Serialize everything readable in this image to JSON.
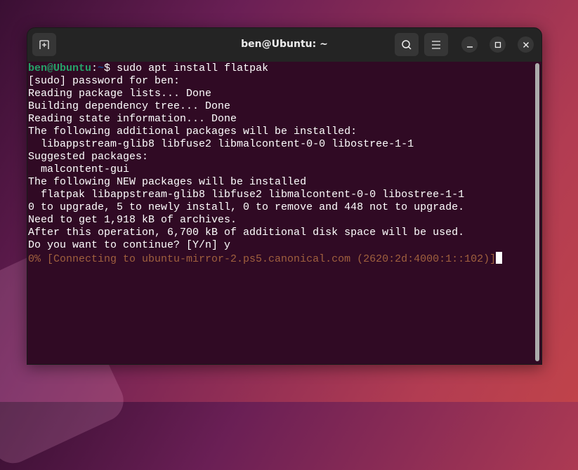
{
  "window": {
    "title": "ben@Ubuntu: ~"
  },
  "header": {
    "new_tab_icon": "new-tab-icon",
    "search_icon": "search-icon",
    "menu_icon": "hamburger-menu-icon",
    "minimize_icon": "minimize-icon",
    "maximize_icon": "maximize-icon",
    "close_icon": "close-icon"
  },
  "terminal": {
    "prompt_user": "ben@Ubuntu",
    "prompt_sep": ":",
    "prompt_path": "~",
    "prompt_symbol": "$ ",
    "command": "sudo apt install flatpak",
    "lines": [
      "[sudo] password for ben:",
      "Reading package lists... Done",
      "Building dependency tree... Done",
      "Reading state information... Done",
      "The following additional packages will be installed:",
      "  libappstream-glib8 libfuse2 libmalcontent-0-0 libostree-1-1",
      "Suggested packages:",
      "  malcontent-gui",
      "The following NEW packages will be installed",
      "  flatpak libappstream-glib8 libfuse2 libmalcontent-0-0 libostree-1-1",
      "0 to upgrade, 5 to newly install, 0 to remove and 448 not to upgrade.",
      "Need to get 1,918 kB of archives.",
      "After this operation, 6,700 kB of additional disk space will be used.",
      "Do you want to continue? [Y/n] y"
    ],
    "progress_line": "0% [Connecting to ubuntu-mirror-2.ps5.canonical.com (2620:2d:4000:1::102)]"
  },
  "colors": {
    "terminal_bg": "#300a24",
    "prompt_user": "#26a269",
    "prompt_path": "#12488b",
    "progress": "#a0603e"
  }
}
